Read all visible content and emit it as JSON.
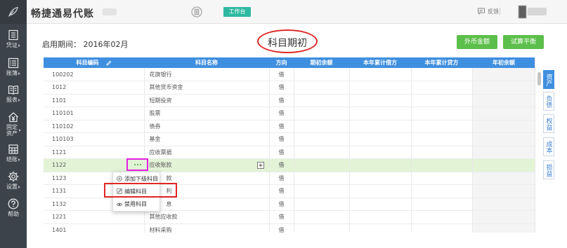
{
  "header": {
    "logo_icon": "leaf-logo-icon",
    "app_title": "畅捷通易代账",
    "document_icon": "document-icon",
    "workbench_tab": "工作台",
    "feedback_icon": "chat-bubble-icon",
    "feedback": "反馈"
  },
  "sidebar": {
    "items": [
      {
        "label": "凭证",
        "icon": "voucher-icon"
      },
      {
        "label": "账簿",
        "icon": "ledger-icon"
      },
      {
        "label": "报表",
        "icon": "report-icon"
      },
      {
        "label": "固定资产",
        "icon": "fixed-asset-icon"
      },
      {
        "label": "结账",
        "icon": "closing-icon"
      },
      {
        "label": "设置",
        "icon": "settings-icon"
      },
      {
        "label": "帮助",
        "icon": "help-icon"
      }
    ]
  },
  "main": {
    "period_label": "启用期间：",
    "period_value": "2016年02月",
    "title": "科目期初",
    "buttons": {
      "foreign_currency": "外币金额",
      "trial_balance": "试算平衡"
    }
  },
  "table": {
    "columns": [
      "科目编码",
      "科目名称",
      "方向",
      "期初余额",
      "本年累计借方",
      "本年累计贷方",
      "年初余额"
    ],
    "rows": [
      {
        "code": "100202",
        "name": "花旗银行",
        "direction": "借"
      },
      {
        "code": "1012",
        "name": "其他货币资金",
        "direction": "借"
      },
      {
        "code": "1101",
        "name": "短期投资",
        "direction": "借"
      },
      {
        "code": "110101",
        "name": "股票",
        "direction": "借"
      },
      {
        "code": "110102",
        "name": "债券",
        "direction": "借"
      },
      {
        "code": "110103",
        "name": "基金",
        "direction": "借"
      },
      {
        "code": "1121",
        "name": "应收票据",
        "direction": "借"
      },
      {
        "code": "1122",
        "name": "应收账款",
        "direction": "借",
        "selected": true
      },
      {
        "code": "1123",
        "name": "款",
        "direction": "借"
      },
      {
        "code": "1131",
        "name": "利",
        "direction": "借"
      },
      {
        "code": "1132",
        "name": "息",
        "direction": "借"
      },
      {
        "code": "1221",
        "name": "其他应收款",
        "direction": "借"
      },
      {
        "code": "1401",
        "name": "材料采购",
        "direction": "借"
      }
    ]
  },
  "context_menu": {
    "items": [
      {
        "label": "添加下级科目",
        "icon": "add-circle-icon"
      },
      {
        "label": "编辑科目",
        "icon": "edit-icon"
      },
      {
        "label": "禁用科目",
        "icon": "eye-icon"
      }
    ]
  },
  "category_tabs": [
    {
      "label": "资产",
      "active": true
    },
    {
      "label": "负债"
    },
    {
      "label": "权益"
    },
    {
      "label": "成本"
    },
    {
      "label": "损益"
    }
  ],
  "colors": {
    "sidebar_bg": "#3d434a",
    "table_header_blue": "#3f8fe0",
    "button_green": "#5dbf4b",
    "workbench_teal": "#2fb9a0",
    "selected_row": "#e3f3d6",
    "annotation_red": "#e02727",
    "annotation_magenta": "#e21fe2"
  }
}
